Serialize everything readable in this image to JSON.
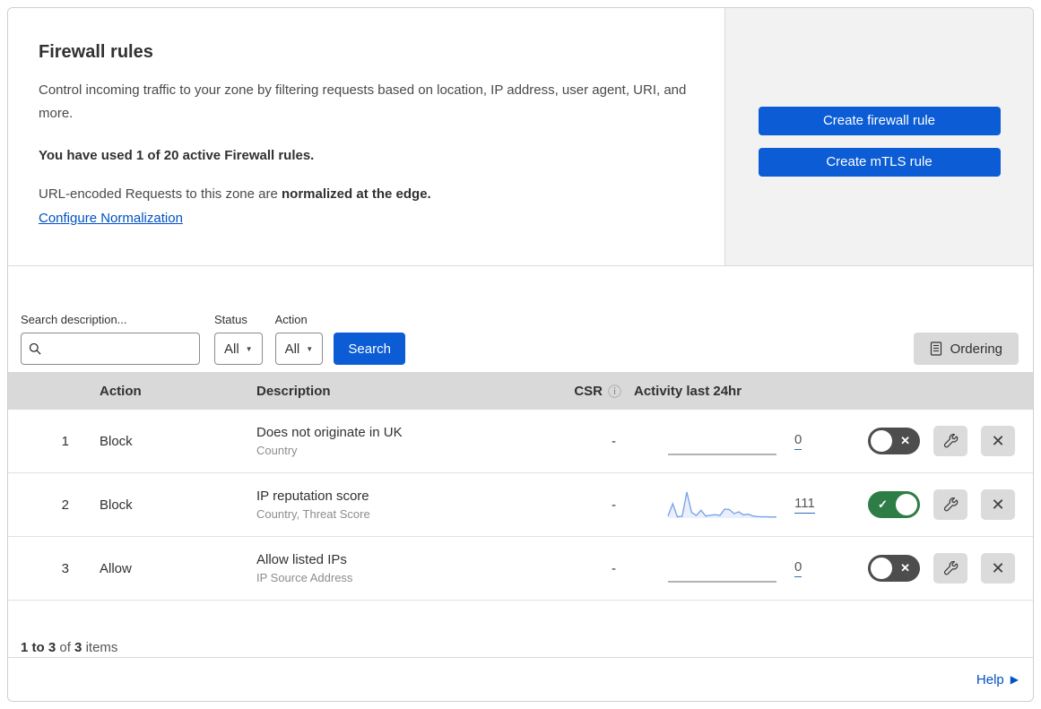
{
  "header": {
    "title": "Firewall rules",
    "description": "Control incoming traffic to your zone by filtering requests based on location, IP address, user agent, URI, and more.",
    "usage_note": "You have used 1 of 20 active Firewall rules.",
    "normalization_prefix": "URL-encoded Requests to this zone are ",
    "normalization_bold": "normalized at the edge.",
    "normalization_link": "Configure Normalization",
    "buttons": [
      {
        "label": "Create firewall rule"
      },
      {
        "label": "Create mTLS rule"
      }
    ]
  },
  "filters": {
    "search_label": "Search description...",
    "search_value": "",
    "status_label": "Status",
    "status_value": "All",
    "action_label": "Action",
    "action_value": "All",
    "search_button": "Search",
    "ordering_button": "Ordering"
  },
  "table": {
    "columns": {
      "action": "Action",
      "description": "Description",
      "csr": "CSR",
      "activity": "Activity last 24hr"
    },
    "rows": [
      {
        "priority": "1",
        "action": "Block",
        "description": "Does not originate in UK",
        "fields": "Country",
        "csr": "-",
        "activity_count": "0",
        "enabled": false,
        "sparkline": [
          0,
          0,
          0,
          0,
          0,
          0,
          0,
          0,
          0,
          0,
          0,
          0,
          0,
          0,
          0,
          0,
          0,
          0,
          0,
          0,
          0,
          0,
          0,
          0
        ]
      },
      {
        "priority": "2",
        "action": "Block",
        "description": "IP reputation score",
        "fields": "Country, Threat Score",
        "csr": "-",
        "activity_count": "111",
        "enabled": true,
        "sparkline": [
          0.08,
          0.55,
          0.05,
          0.07,
          1.0,
          0.22,
          0.1,
          0.3,
          0.08,
          0.11,
          0.13,
          0.1,
          0.34,
          0.33,
          0.17,
          0.24,
          0.12,
          0.15,
          0.08,
          0.06,
          0.05,
          0.05,
          0.04,
          0.05
        ]
      },
      {
        "priority": "3",
        "action": "Allow",
        "description": "Allow listed IPs",
        "fields": "IP Source Address",
        "csr": "-",
        "activity_count": "0",
        "enabled": false,
        "sparkline": [
          0,
          0,
          0,
          0,
          0,
          0,
          0,
          0,
          0,
          0,
          0,
          0,
          0,
          0,
          0,
          0,
          0,
          0,
          0,
          0,
          0,
          0,
          0,
          0
        ]
      }
    ]
  },
  "footer": {
    "range_bold": "1 to 3",
    "of_text": "of",
    "total_bold": "3",
    "items_text": "items",
    "help_label": "Help"
  },
  "colors": {
    "accent_blue": "#0b5cd5",
    "link_blue": "#0051c3",
    "toggle_on_green": "#2e7d46",
    "toggle_off_gray": "#4d4d4d",
    "sparkline_blue": "#7aa5e8",
    "sparkline_fill": "#e9f0fb",
    "sparkline_flat_gray": "#9a9a9a",
    "table_header_gray": "#d9d9d9"
  }
}
